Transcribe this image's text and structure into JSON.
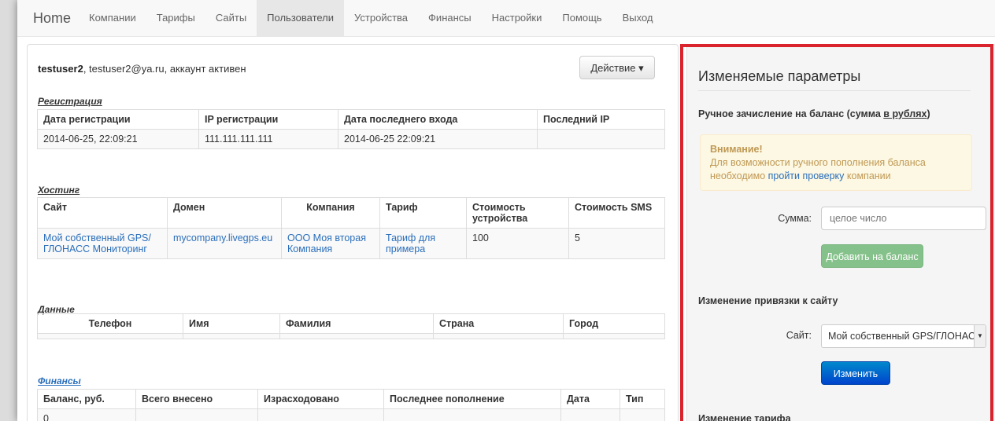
{
  "nav": {
    "brand": "Home",
    "items": [
      "Компании",
      "Тарифы",
      "Сайты",
      "Пользователи",
      "Устройства",
      "Финансы",
      "Настройки",
      "Помощь",
      "Выход"
    ]
  },
  "user": {
    "login": "testuser2",
    "rest": ", testuser2@ya.ru, аккаунт активен",
    "action_label": "Действие ▾"
  },
  "registration": {
    "title": "Регистрация",
    "headers": [
      "Дата регистрации",
      "IP регистрации",
      "Дата последнего входа",
      "Последний IP"
    ],
    "row": [
      "2014-06-25, 22:09:21",
      "111.111.111.111",
      "2014-06-25 22:09:21",
      ""
    ]
  },
  "hosting": {
    "title": "Хостинг",
    "headers": [
      "Сайт",
      "Домен",
      "Компания",
      "Тариф",
      "Стоимость устройства",
      "Стоимость SMS"
    ],
    "row": [
      "Мой собственный GPS/ ГЛОНАСС Мониторинг",
      "mycompany.livegps.eu",
      "ООО Моя вторая Компания",
      "Тариф для примера",
      "100",
      "5"
    ]
  },
  "data": {
    "title": "Данные",
    "headers": [
      "Телефон",
      "Имя",
      "Фамилия",
      "Страна",
      "Город"
    ]
  },
  "finance": {
    "title": "Финансы",
    "headers": [
      "Баланс, руб.",
      "Всего внесено",
      "Израсходовано",
      "Последнее пополнение",
      "Дата",
      "Тип"
    ],
    "row": [
      "0",
      "",
      "",
      "",
      "",
      ""
    ]
  },
  "side": {
    "title": "Изменяемые параметры",
    "balance_heading": "Ручное зачисление на баланс (сумма ",
    "balance_heading_link": "в рублях",
    "balance_heading_end": ")",
    "alert_title": "Внимание!",
    "alert_text_1": "Для возможности ручного пополнения баланса необходимо ",
    "alert_link": "пройти проверку",
    "alert_text_2": " компании",
    "sum_label": "Сумма:",
    "sum_placeholder": "целое число",
    "add_button": "Добавить на баланс",
    "site_heading": "Изменение привязки к сайту",
    "site_label": "Сайт:",
    "site_value": "Мой собственный GPS/ГЛОНАСС Мониторинг",
    "change_button": "Изменить",
    "tariff_heading": "Изменение тарифа"
  },
  "colors": {
    "highlight_border": "#d9232d",
    "link": "#2a6ebb",
    "alert_text": "#c09853"
  }
}
